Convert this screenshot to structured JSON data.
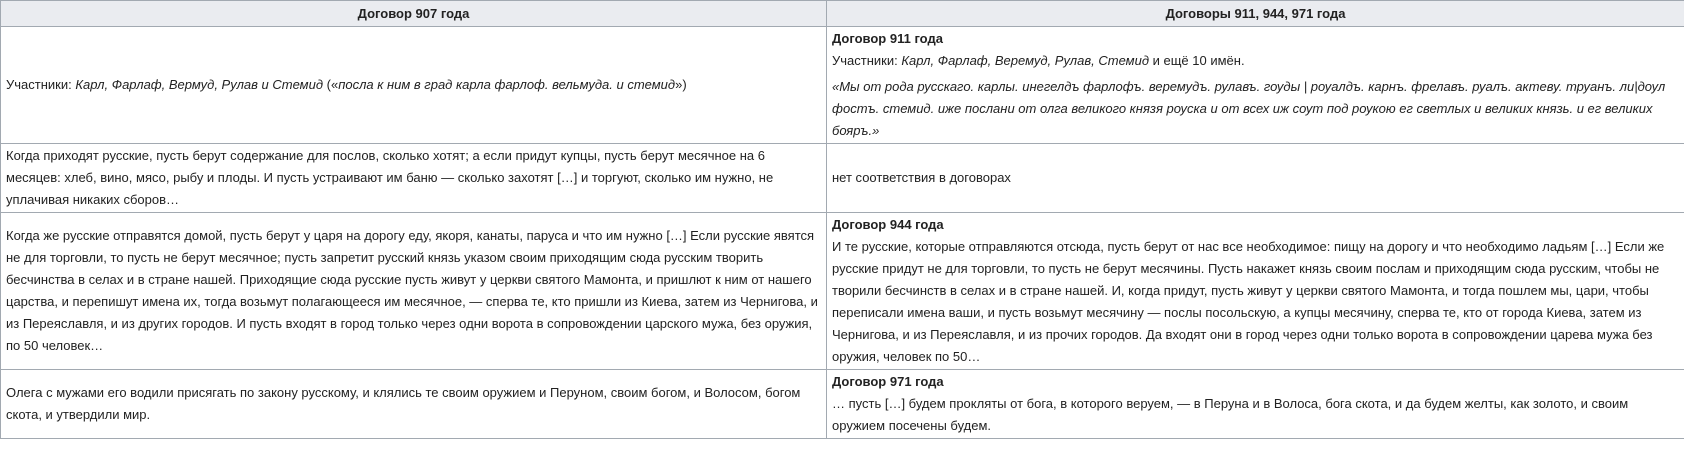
{
  "table": {
    "headers": [
      "Договор 907 года",
      "Договоры 911, 944, 971 года"
    ],
    "row1": {
      "left": {
        "prefix": "Участники: ",
        "names": "Карл, Фарлаф, Вермуд, Рулав и Стемид",
        "mid": " («",
        "quote": "посла к ним в град карла фарлоф. вельмуда. и стемид",
        "suffix": "»)"
      },
      "right": {
        "title": "Договор 911 года",
        "prefix": "Участники: ",
        "names": "Карл, Фарлаф, Веремуд, Рулав, Стемид",
        "suffix": " и ещё 10 имён.",
        "quote": "«Мы от рода русскаго. карлы. инегелдъ фарлофъ. веремудъ. рулавъ. гоуды | роуалдъ. карнъ. фрелавъ. руалъ. актеву. труанъ. ли|доул фостъ. стемид. иже послани от олга великого князя роуска и от всех иж соут под роукою ег светлых и великих князь. и ег великих бояръ.»"
      }
    },
    "row2": {
      "left": "Когда приходят русские, пусть берут содержание для послов, сколько хотят; а если придут купцы, пусть берут месячное на 6 месяцев: хлеб, вино, мясо, рыбу и плоды. И пусть устраивают им баню — сколько захотят […] и торгуют, сколько им нужно, не уплачивая никаких сборов…",
      "right": "нет соответствия в договорах"
    },
    "row3": {
      "left": "Когда же русские отправятся домой, пусть берут у царя на дорогу еду, якоря, канаты, паруса и что им нужно […] Если русские явятся не для торговли, то пусть не берут месячное; пусть запретит русский князь указом своим приходящим сюда русским творить бесчинства в селах и в стране нашей. Приходящие сюда русские пусть живут у церкви святого Мамонта, и пришлют к ним от нашего царства, и перепишут имена их, тогда возьмут полагающееся им месячное, — сперва те, кто пришли из Киева, затем из Чернигова, и из Переяславля, и из других городов. И пусть входят в город только через одни ворота в сопровождении царского мужа, без оружия, по 50 человек…",
      "right_title": "Договор 944 года",
      "right": "И те русские, которые отправляются отсюда, пусть берут от нас все необходимое: пищу на дорогу и что необходимо ладьям […] Если же русские придут не для торговли, то пусть не берут месячины. Пусть накажет князь своим послам и приходящим сюда русским, чтобы не творили бесчинств в селах и в стране нашей. И, когда придут, пусть живут у церкви святого Мамонта, и тогда пошлем мы, цари, чтобы переписали имена ваши, и пусть возьмут месячину — послы посольскую, а купцы месячину, сперва те, кто от города Киева, затем из Чернигова, и из Переяславля, и из прочих городов. Да входят они в город через одни только ворота в сопровождении царева мужа без оружия, человек по 50…"
    },
    "row4": {
      "left": "Олега с мужами его водили присягать по закону русскому, и клялись те своим оружием и Перуном, своим богом, и Волосом, богом скота, и утвердили мир.",
      "right_title": "Договор 971 года",
      "right": "… пусть […] будем прокляты от бога, в которого веруем, — в Перуна и в Волоса, бога скота, и да будем желты, как золото, и своим оружием посечены будем."
    }
  }
}
